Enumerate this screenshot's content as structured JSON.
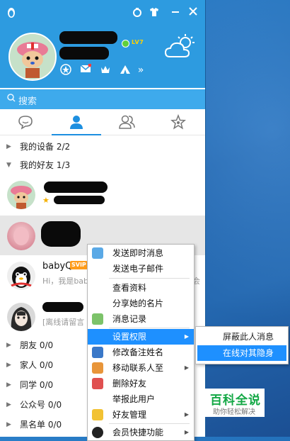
{
  "header": {
    "level_badge": "LV7",
    "double_arrow": "»"
  },
  "search": {
    "placeholder": "搜索"
  },
  "tabs": [
    {
      "icon": "chat-bubble-icon"
    },
    {
      "icon": "contact-person-icon",
      "active": true
    },
    {
      "icon": "group-icon"
    },
    {
      "icon": "star-icon"
    }
  ],
  "groups": {
    "devices": "我的设备",
    "devices_count": "2/2",
    "friends": "我的好友",
    "friends_count": "1/3",
    "friend_group": "朋友",
    "friend_group_count": "0/0",
    "family_group": "家人",
    "family_group_count": "0/0",
    "classmate_group": "同学",
    "classmate_group_count": "0/0",
    "public_group": "公众号",
    "public_group_count": "0/0",
    "blacklist_group": "黑名单",
    "blacklist_group_count": "0/0"
  },
  "contacts": {
    "babyq_name": "babyQ",
    "babyq_badge": "SVIP",
    "babyq_sig": "Hi，我是baby",
    "babyq_sig_tail": "会",
    "c4_sig": "[离线请留言"
  },
  "menu": {
    "send_im": "发送即时消息",
    "send_email": "发送电子邮件",
    "view_profile": "查看资料",
    "share_card": "分享她的名片",
    "msg_history": "消息记录",
    "permissions": "设置权限",
    "edit_remark": "修改备注姓名",
    "move_contact": "移动联系人至",
    "delete_friend": "删除好友",
    "report_user": "举报此用户",
    "friend_mgmt": "好友管理",
    "vip_shortcut": "会员快捷功能"
  },
  "submenu": {
    "block_messages": "屏蔽此人消息",
    "invisible_online": "在线对其隐身"
  },
  "watermark": {
    "title": "百科全说",
    "subtitle": "助你轻松解决"
  },
  "colors": {
    "header_blue": "#2d9be0",
    "menu_highlight": "#1e90ff",
    "watermark_green": "#13a845"
  }
}
